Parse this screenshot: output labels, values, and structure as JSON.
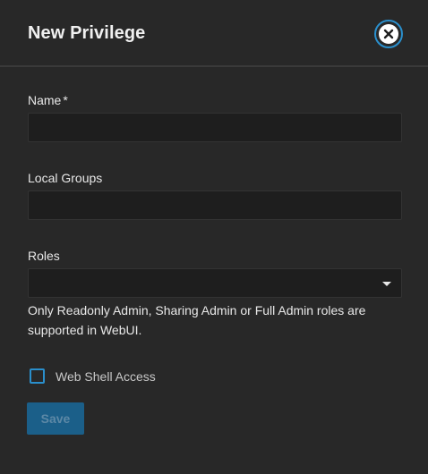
{
  "dialog": {
    "title": "New Privilege",
    "close_icon": "close-circle-icon"
  },
  "form": {
    "name": {
      "label": "Name",
      "required_mark": "*",
      "value": ""
    },
    "local_groups": {
      "label": "Local Groups",
      "value": ""
    },
    "roles": {
      "label": "Roles",
      "value": "",
      "dropdown_icon": "caret-down-icon",
      "hint": "Only Readonly Admin, Sharing Admin or Full Admin roles are supported in WebUI."
    },
    "web_shell_access": {
      "label": "Web Shell Access",
      "checked": false
    },
    "save_label": "Save"
  },
  "colors": {
    "background": "#282828",
    "input_background": "#1e1e1e",
    "accent": "#2a8fcc",
    "save_disabled_bg": "#1b5f89",
    "save_disabled_text": "#5c88a6"
  }
}
